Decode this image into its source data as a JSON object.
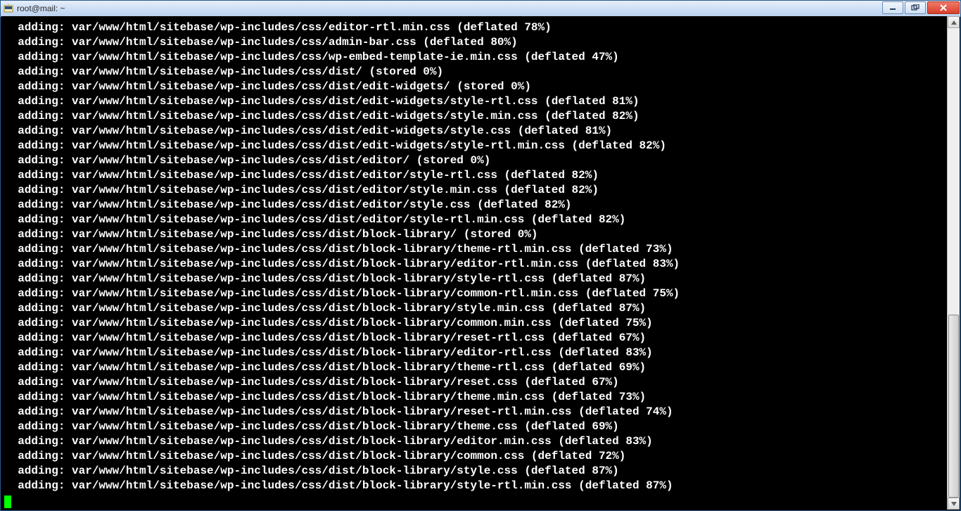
{
  "window": {
    "title": "root@mail: ~"
  },
  "terminal": {
    "lines": [
      "  adding: var/www/html/sitebase/wp-includes/css/editor-rtl.min.css (deflated 78%)",
      "  adding: var/www/html/sitebase/wp-includes/css/admin-bar.css (deflated 80%)",
      "  adding: var/www/html/sitebase/wp-includes/css/wp-embed-template-ie.min.css (deflated 47%)",
      "  adding: var/www/html/sitebase/wp-includes/css/dist/ (stored 0%)",
      "  adding: var/www/html/sitebase/wp-includes/css/dist/edit-widgets/ (stored 0%)",
      "  adding: var/www/html/sitebase/wp-includes/css/dist/edit-widgets/style-rtl.css (deflated 81%)",
      "  adding: var/www/html/sitebase/wp-includes/css/dist/edit-widgets/style.min.css (deflated 82%)",
      "  adding: var/www/html/sitebase/wp-includes/css/dist/edit-widgets/style.css (deflated 81%)",
      "  adding: var/www/html/sitebase/wp-includes/css/dist/edit-widgets/style-rtl.min.css (deflated 82%)",
      "  adding: var/www/html/sitebase/wp-includes/css/dist/editor/ (stored 0%)",
      "  adding: var/www/html/sitebase/wp-includes/css/dist/editor/style-rtl.css (deflated 82%)",
      "  adding: var/www/html/sitebase/wp-includes/css/dist/editor/style.min.css (deflated 82%)",
      "  adding: var/www/html/sitebase/wp-includes/css/dist/editor/style.css (deflated 82%)",
      "  adding: var/www/html/sitebase/wp-includes/css/dist/editor/style-rtl.min.css (deflated 82%)",
      "  adding: var/www/html/sitebase/wp-includes/css/dist/block-library/ (stored 0%)",
      "  adding: var/www/html/sitebase/wp-includes/css/dist/block-library/theme-rtl.min.css (deflated 73%)",
      "  adding: var/www/html/sitebase/wp-includes/css/dist/block-library/editor-rtl.min.css (deflated 83%)",
      "  adding: var/www/html/sitebase/wp-includes/css/dist/block-library/style-rtl.css (deflated 87%)",
      "  adding: var/www/html/sitebase/wp-includes/css/dist/block-library/common-rtl.min.css (deflated 75%)",
      "  adding: var/www/html/sitebase/wp-includes/css/dist/block-library/style.min.css (deflated 87%)",
      "  adding: var/www/html/sitebase/wp-includes/css/dist/block-library/common.min.css (deflated 75%)",
      "  adding: var/www/html/sitebase/wp-includes/css/dist/block-library/reset-rtl.css (deflated 67%)",
      "  adding: var/www/html/sitebase/wp-includes/css/dist/block-library/editor-rtl.css (deflated 83%)",
      "  adding: var/www/html/sitebase/wp-includes/css/dist/block-library/theme-rtl.css (deflated 69%)",
      "  adding: var/www/html/sitebase/wp-includes/css/dist/block-library/reset.css (deflated 67%)",
      "  adding: var/www/html/sitebase/wp-includes/css/dist/block-library/theme.min.css (deflated 73%)",
      "  adding: var/www/html/sitebase/wp-includes/css/dist/block-library/reset-rtl.min.css (deflated 74%)",
      "  adding: var/www/html/sitebase/wp-includes/css/dist/block-library/theme.css (deflated 69%)",
      "  adding: var/www/html/sitebase/wp-includes/css/dist/block-library/editor.min.css (deflated 83%)",
      "  adding: var/www/html/sitebase/wp-includes/css/dist/block-library/common.css (deflated 72%)",
      "  adding: var/www/html/sitebase/wp-includes/css/dist/block-library/style.css (deflated 87%)",
      "  adding: var/www/html/sitebase/wp-includes/css/dist/block-library/style-rtl.min.css (deflated 87%)"
    ]
  }
}
